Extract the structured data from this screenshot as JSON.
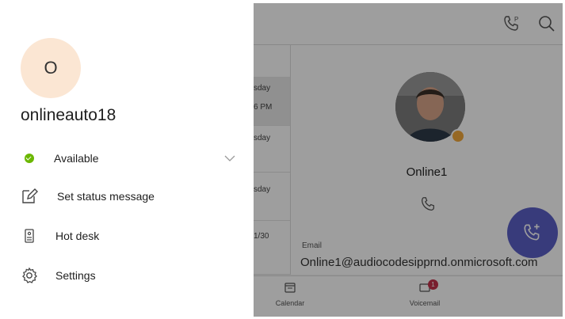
{
  "profile": {
    "initial": "O",
    "name": "onlineauto18"
  },
  "menu": [
    {
      "label": "Available",
      "icon": "available-status-icon",
      "has_dropdown": true
    },
    {
      "label": "Set status message",
      "icon": "edit-status-icon"
    },
    {
      "label": "Hot desk",
      "icon": "hot-desk-icon"
    },
    {
      "label": "Settings",
      "icon": "gear-icon"
    }
  ],
  "list": [
    {
      "day": "sday",
      "time": "6 PM"
    },
    {
      "day": "sday",
      "time": ""
    },
    {
      "day": "sday",
      "time": ""
    },
    {
      "day": "1/30",
      "time": ""
    }
  ],
  "contact": {
    "name": "Online1",
    "email_label": "Email",
    "email": "Online1@audiocodesipprnd.onmicrosoft.com",
    "presence_color": "#f2a93b"
  },
  "nav": [
    {
      "label": "Calendar",
      "icon": "calendar-icon"
    },
    {
      "label": "Voicemail",
      "icon": "voicemail-icon",
      "badge": "1"
    }
  ],
  "colors": {
    "available": "#6bb700",
    "accent": "#5b5fc7",
    "avatar_bg": "#fbe6d3"
  }
}
